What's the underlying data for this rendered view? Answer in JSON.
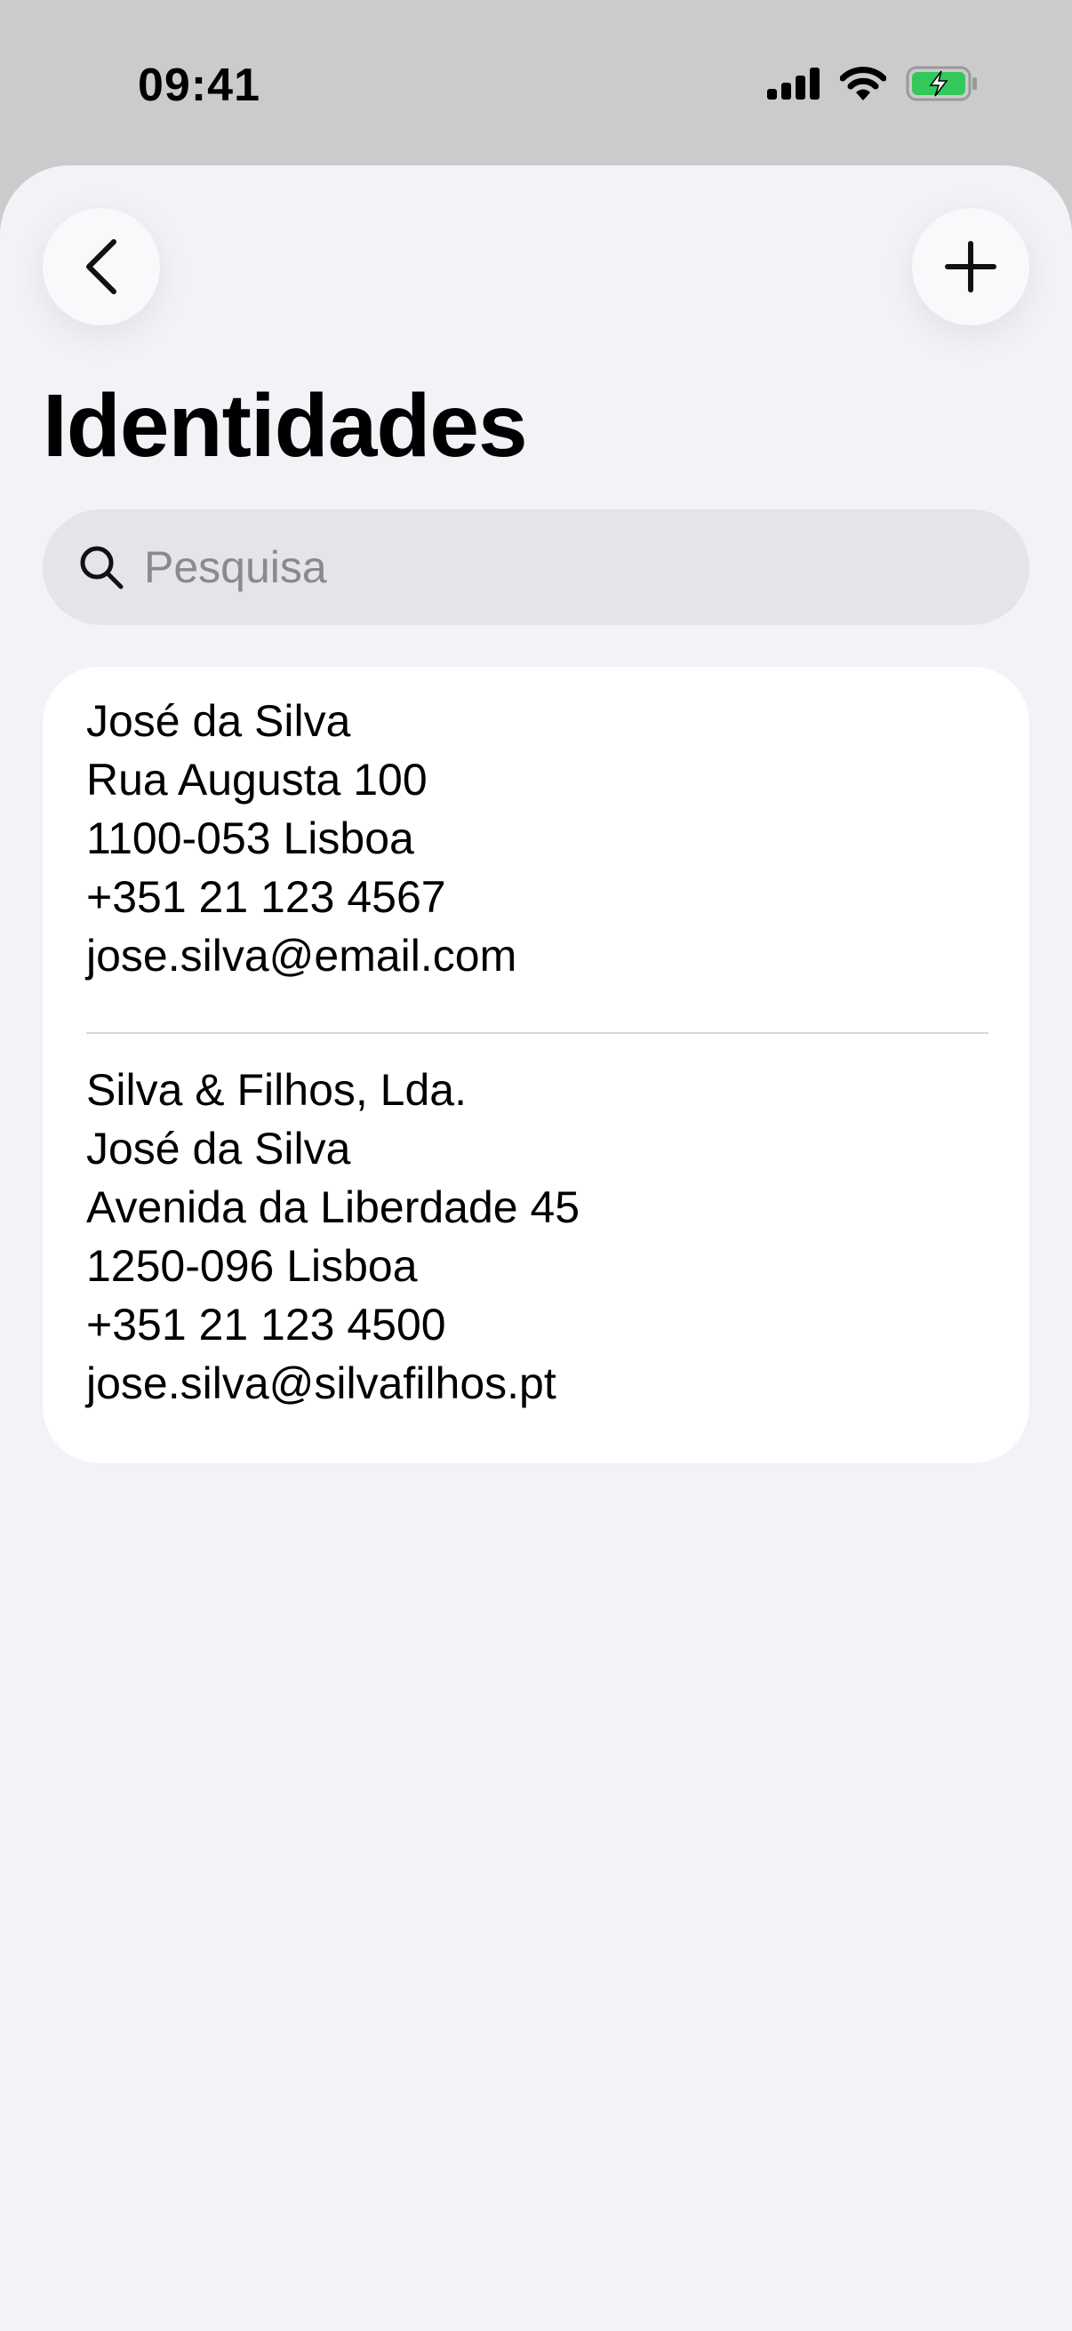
{
  "status_bar": {
    "time": "09:41",
    "icons": [
      "cellular-signal-icon",
      "wifi-icon",
      "battery-charging-icon"
    ],
    "battery_color": "#34c759"
  },
  "nav": {
    "back_icon": "chevron-left-icon",
    "add_icon": "plus-icon",
    "title": "Identidades"
  },
  "search": {
    "placeholder": "Pesquisa",
    "value": "",
    "icon": "search-icon"
  },
  "identities": [
    {
      "lines": [
        "José da Silva",
        "Rua Augusta 100",
        "1100-053 Lisboa",
        "+351 21 123 4567",
        "jose.silva@email.com"
      ]
    },
    {
      "lines": [
        "Silva & Filhos, Lda.",
        "José da Silva",
        "Avenida da Liberdade 45",
        "1250-096 Lisboa",
        "+351 21 123 4500",
        "jose.silva@silvafilhos.pt"
      ]
    }
  ]
}
